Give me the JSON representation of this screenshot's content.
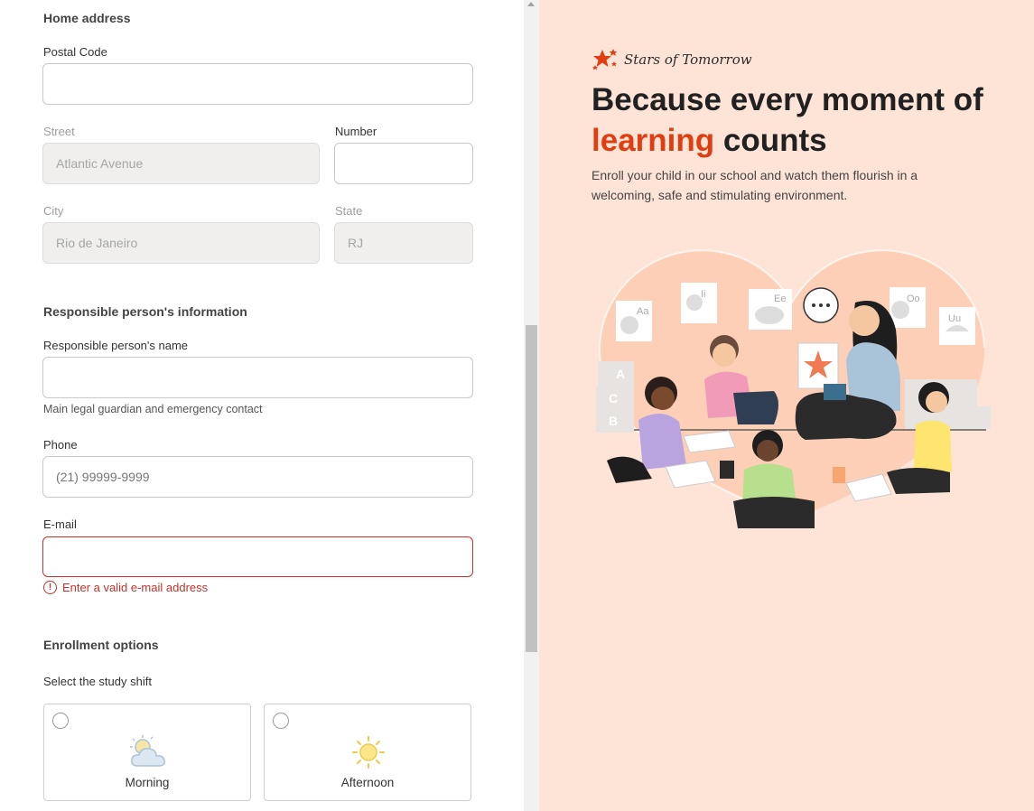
{
  "home": {
    "section_title": "Home address",
    "postal_label": "Postal Code",
    "postal_value": "",
    "street_label": "Street",
    "street_value": "Atlantic Avenue",
    "number_label": "Number",
    "number_value": "",
    "city_label": "City",
    "city_value": "Rio de Janeiro",
    "state_label": "State",
    "state_value": "RJ"
  },
  "responsible": {
    "section_title": "Responsible person's information",
    "name_label": "Responsible person's name",
    "name_value": "",
    "name_helper": "Main legal guardian and emergency contact",
    "phone_label": "Phone",
    "phone_placeholder": "(21) 99999-9999",
    "email_label": "E-mail",
    "email_value": "",
    "email_error": "Enter a valid e-mail address"
  },
  "enrollment": {
    "section_title": "Enrollment options",
    "shift_prompt": "Select the study shift",
    "shifts": [
      {
        "label": "Morning",
        "icon": "cloud-sun-icon",
        "selected": false
      },
      {
        "label": "Afternoon",
        "icon": "sun-icon",
        "selected": false
      }
    ]
  },
  "hero": {
    "brand": "Stars of Tomorrow",
    "headline_part1": "Because every moment of",
    "headline_accent": "learning",
    "headline_part2": "counts",
    "subtitle": "Enroll your child in our school and watch them flourish in a welcoming, safe and stimulating environment.",
    "cards": [
      "Aa",
      "Ii",
      "Ee",
      "Oo",
      "Uu"
    ],
    "blocks": [
      "A",
      "C",
      "B"
    ]
  },
  "colors": {
    "accent": "#e03e10",
    "hero_bg": "#fde4d7",
    "error": "#c9302c"
  }
}
